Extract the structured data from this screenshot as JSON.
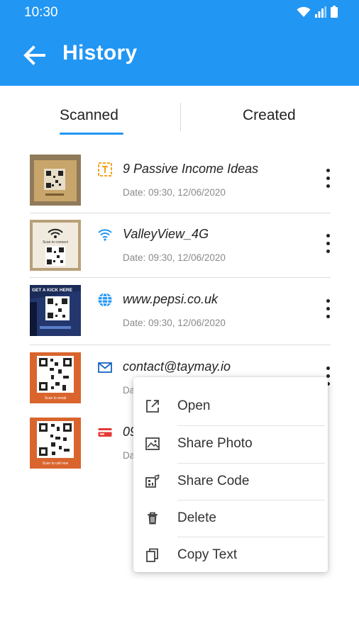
{
  "status_bar": {
    "time": "10:30"
  },
  "app_bar": {
    "title": "History"
  },
  "tabs": [
    {
      "label": "Scanned",
      "selected": true
    },
    {
      "label": "Created",
      "selected": false
    }
  ],
  "accent_color": "#2196f3",
  "items": [
    {
      "title": "9 Passive Income Ideas",
      "date": "Date: 09:30, 12/06/2020",
      "type_icon": "text-icon",
      "icon_color": "#f5a623"
    },
    {
      "title": "ValleyView_4G",
      "date": "Date: 09:30, 12/06/2020",
      "type_icon": "wifi-icon",
      "icon_color": "#2196f3",
      "thumb_text": "Scan to connect"
    },
    {
      "title": "www.pepsi.co.uk",
      "date": "Date: 09:30, 12/06/2020",
      "type_icon": "web-icon",
      "icon_color": "#2196f3",
      "thumb_text": "GET A KICK HERE"
    },
    {
      "title": "contact@taymay.io",
      "date": "Da",
      "type_icon": "email-icon",
      "icon_color": "#1565c0",
      "thumb_text": "Scan to email"
    },
    {
      "title": "09",
      "date": "Da",
      "type_icon": "card-icon",
      "icon_color": "#e53935",
      "thumb_text": "Scan to call now"
    }
  ],
  "menu": {
    "items": [
      {
        "label": "Open",
        "icon": "open-external-icon"
      },
      {
        "label": "Share Photo",
        "icon": "image-icon"
      },
      {
        "label": "Share Code",
        "icon": "share-code-icon"
      },
      {
        "label": "Delete",
        "icon": "trash-icon"
      },
      {
        "label": "Copy Text",
        "icon": "copy-icon"
      }
    ]
  }
}
